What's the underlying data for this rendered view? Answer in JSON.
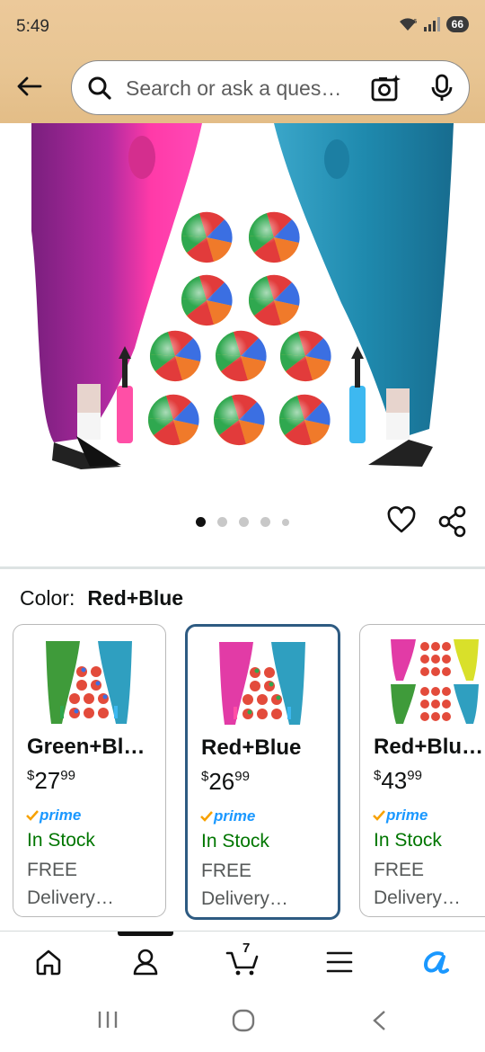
{
  "status_bar": {
    "time": "5:49",
    "battery": "66"
  },
  "search": {
    "placeholder": "Search or ask a ques…"
  },
  "gallery": {
    "dot_count": 5,
    "active_index": 0
  },
  "color_selection": {
    "label": "Color:",
    "selected_value": "Red+Blue"
  },
  "variants": [
    {
      "title": "Green+Bl…",
      "price_symbol": "$",
      "price_whole": "27",
      "price_fraction": "99",
      "prime": "prime",
      "stock": "In Stock",
      "free": "FREE",
      "delivery": "Delivery…",
      "selected": false
    },
    {
      "title": "Red+Blue",
      "price_symbol": "$",
      "price_whole": "26",
      "price_fraction": "99",
      "prime": "prime",
      "stock": "In Stock",
      "free": "FREE",
      "delivery": "Delivery…",
      "selected": true
    },
    {
      "title": "Red+Blu…",
      "price_symbol": "$",
      "price_whole": "43",
      "price_fraction": "99",
      "prime": "prime",
      "stock": "In Stock",
      "free": "FREE",
      "delivery": "Delivery…",
      "selected": false
    }
  ],
  "bottom_nav": {
    "cart_count": "7",
    "active": "account"
  },
  "colors": {
    "header_bg": "#e8c593",
    "selected_border": "#2e5b82",
    "in_stock": "#007600",
    "prime_blue": "#1a98ff",
    "prime_check": "#f7a100",
    "alexa_blue": "#1a98ff"
  }
}
